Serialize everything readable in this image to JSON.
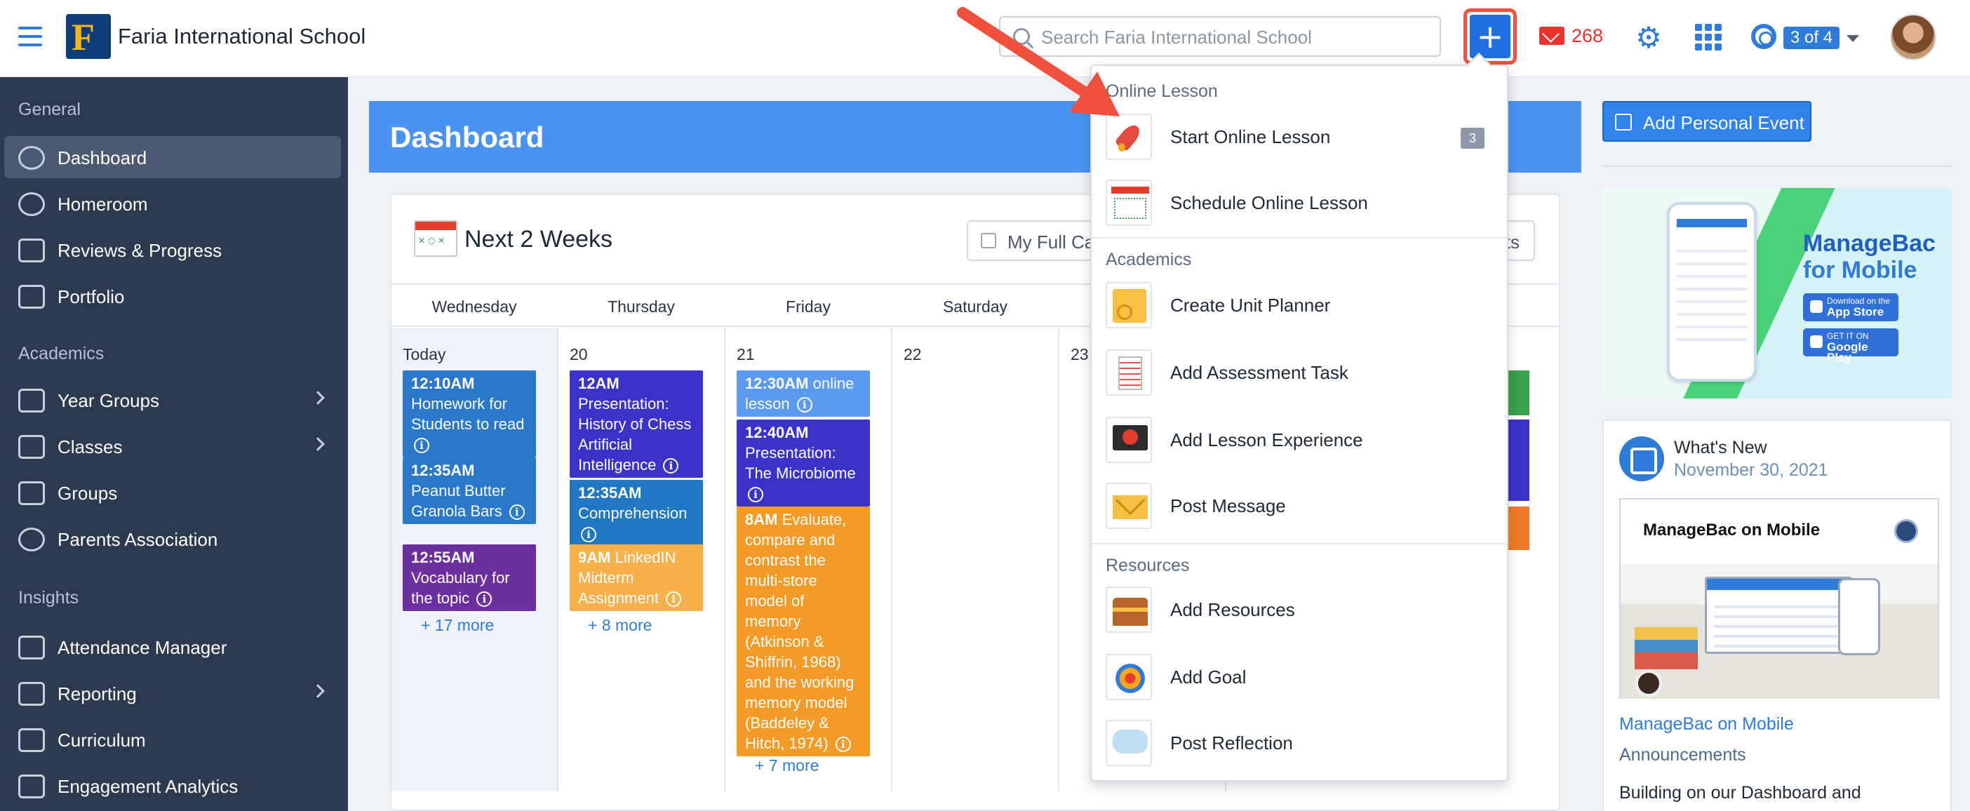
{
  "header": {
    "school_name": "Faria International School",
    "logo_letter": "F",
    "search_placeholder": "Search Faria International School",
    "add_label": "+",
    "mail_count": "268",
    "pager": "3 of 4",
    "accent": "#2f7bd9"
  },
  "sidebar": {
    "sections": [
      {
        "title": "General",
        "items": [
          {
            "label": "Dashboard",
            "icon": "gauge-icon",
            "active": true
          },
          {
            "label": "Homeroom",
            "icon": "clock-icon"
          },
          {
            "label": "Reviews & Progress",
            "icon": "chart-icon"
          },
          {
            "label": "Portfolio",
            "icon": "briefcase-icon"
          }
        ]
      },
      {
        "title": "Academics",
        "items": [
          {
            "label": "Year Groups",
            "icon": "layers-icon",
            "chevron": true
          },
          {
            "label": "Classes",
            "icon": "stack-icon",
            "chevron": true
          },
          {
            "label": "Groups",
            "icon": "cube-icon"
          },
          {
            "label": "Parents Association",
            "icon": "people-icon"
          }
        ]
      },
      {
        "title": "Insights",
        "items": [
          {
            "label": "Attendance Manager",
            "icon": "calendar-clock-icon"
          },
          {
            "label": "Reporting",
            "icon": "report-icon",
            "chevron": true
          },
          {
            "label": "Curriculum",
            "icon": "map-icon"
          },
          {
            "label": "Engagement Analytics",
            "icon": "analytics-icon"
          }
        ]
      }
    ]
  },
  "dashboard": {
    "title": "Dashboard",
    "panel_title": "Next 2 Weeks",
    "my_full_calendar": "My Full Calendar",
    "right_button_tail": "ts",
    "days": [
      "Wednesday",
      "Thursday",
      "Friday",
      "Saturday"
    ],
    "columns": [
      {
        "date": "Today",
        "events": [
          {
            "time": "12:10AM",
            "text": "Homework for Students to read",
            "color": "#2a78c9"
          },
          {
            "time": "12:35AM",
            "text": "Peanut Butter Granola Bars",
            "color": "#2a78c9"
          },
          {
            "time": "12:55AM",
            "text": "Vocabulary for the topic",
            "color": "#6b2fa0"
          }
        ],
        "more": "+ 17 more"
      },
      {
        "date": "20",
        "events": [
          {
            "time": "12AM",
            "text": "Presentation: History of Chess Artificial Intelligence",
            "color": "#3b33c9"
          },
          {
            "time": "12:35AM",
            "text": "Comprehension",
            "color": "#1f78c1"
          },
          {
            "time": "9AM",
            "text": "LinkedIN Midterm Assignment",
            "color": "#f7b04a"
          }
        ],
        "more": "+ 8 more"
      },
      {
        "date": "21",
        "events": [
          {
            "time": "12:30AM",
            "text": "online lesson",
            "color": "#5b9bef"
          },
          {
            "time": "12:40AM",
            "text": "Presentation: The Microbiome",
            "color": "#3b33c9"
          },
          {
            "time": "8AM",
            "text": "Evaluate, compare and contrast the multi-store model of memory (Atkinson & Shiffrin, 1968) and the working memory model (Baddeley & Hitch, 1974)",
            "color": "#f39a27"
          }
        ],
        "more": "+ 7 more"
      },
      {
        "date": "22",
        "events": [],
        "more": ""
      },
      {
        "date": "23",
        "events": [],
        "more": ""
      }
    ]
  },
  "right": {
    "add_personal_event": "Add Personal Event",
    "promo_line1": "ManageBac",
    "promo_line2": "for Mobile",
    "app_store_small": "Download on the",
    "app_store": "App Store",
    "google_small": "GET IT ON",
    "google": "Google Play",
    "news_title": "What's New",
    "news_date": "November 30, 2021",
    "news_image_title": "ManageBac on Mobile",
    "news_link": "ManageBac on Mobile",
    "news_category": "Announcements",
    "news_body": "Building on our Dashboard and"
  },
  "dropdown": {
    "sections": [
      {
        "title": "Online Lesson",
        "items": [
          {
            "label": "Start Online Lesson",
            "icon": "rocket-icon",
            "badge": "3"
          },
          {
            "label": "Schedule Online Lesson",
            "icon": "calendar-icon"
          }
        ]
      },
      {
        "title": "Academics",
        "items": [
          {
            "label": "Create Unit Planner",
            "icon": "unit-planner-icon"
          },
          {
            "label": "Add Assessment Task",
            "icon": "checklist-icon"
          },
          {
            "label": "Add Lesson Experience",
            "icon": "video-lesson-icon"
          },
          {
            "label": "Post Message",
            "icon": "envelope-icon"
          }
        ]
      },
      {
        "title": "Resources",
        "items": [
          {
            "label": "Add Resources",
            "icon": "treasure-chest-icon"
          },
          {
            "label": "Add Goal",
            "icon": "target-icon"
          },
          {
            "label": "Post Reflection",
            "icon": "speech-bubble-icon"
          }
        ]
      }
    ]
  }
}
